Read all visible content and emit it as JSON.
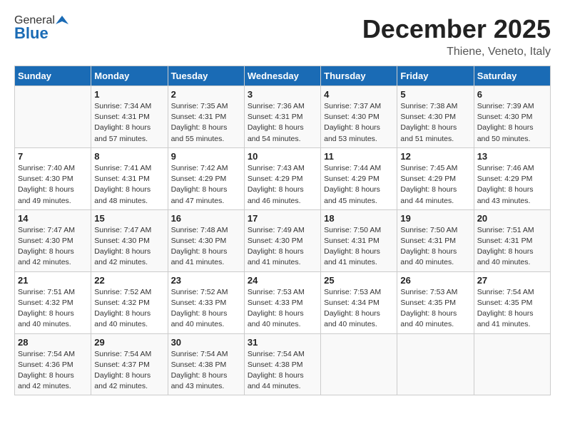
{
  "header": {
    "logo_general": "General",
    "logo_blue": "Blue",
    "month_title": "December 2025",
    "location": "Thiene, Veneto, Italy"
  },
  "days_of_week": [
    "Sunday",
    "Monday",
    "Tuesday",
    "Wednesday",
    "Thursday",
    "Friday",
    "Saturday"
  ],
  "weeks": [
    [
      {
        "day": "",
        "info": ""
      },
      {
        "day": "1",
        "info": "Sunrise: 7:34 AM\nSunset: 4:31 PM\nDaylight: 8 hours\nand 57 minutes."
      },
      {
        "day": "2",
        "info": "Sunrise: 7:35 AM\nSunset: 4:31 PM\nDaylight: 8 hours\nand 55 minutes."
      },
      {
        "day": "3",
        "info": "Sunrise: 7:36 AM\nSunset: 4:31 PM\nDaylight: 8 hours\nand 54 minutes."
      },
      {
        "day": "4",
        "info": "Sunrise: 7:37 AM\nSunset: 4:30 PM\nDaylight: 8 hours\nand 53 minutes."
      },
      {
        "day": "5",
        "info": "Sunrise: 7:38 AM\nSunset: 4:30 PM\nDaylight: 8 hours\nand 51 minutes."
      },
      {
        "day": "6",
        "info": "Sunrise: 7:39 AM\nSunset: 4:30 PM\nDaylight: 8 hours\nand 50 minutes."
      }
    ],
    [
      {
        "day": "7",
        "info": "Sunrise: 7:40 AM\nSunset: 4:30 PM\nDaylight: 8 hours\nand 49 minutes."
      },
      {
        "day": "8",
        "info": "Sunrise: 7:41 AM\nSunset: 4:31 PM\nDaylight: 8 hours\nand 48 minutes."
      },
      {
        "day": "9",
        "info": "Sunrise: 7:42 AM\nSunset: 4:29 PM\nDaylight: 8 hours\nand 47 minutes."
      },
      {
        "day": "10",
        "info": "Sunrise: 7:43 AM\nSunset: 4:29 PM\nDaylight: 8 hours\nand 46 minutes."
      },
      {
        "day": "11",
        "info": "Sunrise: 7:44 AM\nSunset: 4:29 PM\nDaylight: 8 hours\nand 45 minutes."
      },
      {
        "day": "12",
        "info": "Sunrise: 7:45 AM\nSunset: 4:29 PM\nDaylight: 8 hours\nand 44 minutes."
      },
      {
        "day": "13",
        "info": "Sunrise: 7:46 AM\nSunset: 4:29 PM\nDaylight: 8 hours\nand 43 minutes."
      }
    ],
    [
      {
        "day": "14",
        "info": "Sunrise: 7:47 AM\nSunset: 4:30 PM\nDaylight: 8 hours\nand 42 minutes."
      },
      {
        "day": "15",
        "info": "Sunrise: 7:47 AM\nSunset: 4:30 PM\nDaylight: 8 hours\nand 42 minutes."
      },
      {
        "day": "16",
        "info": "Sunrise: 7:48 AM\nSunset: 4:30 PM\nDaylight: 8 hours\nand 41 minutes."
      },
      {
        "day": "17",
        "info": "Sunrise: 7:49 AM\nSunset: 4:30 PM\nDaylight: 8 hours\nand 41 minutes."
      },
      {
        "day": "18",
        "info": "Sunrise: 7:50 AM\nSunset: 4:31 PM\nDaylight: 8 hours\nand 41 minutes."
      },
      {
        "day": "19",
        "info": "Sunrise: 7:50 AM\nSunset: 4:31 PM\nDaylight: 8 hours\nand 40 minutes."
      },
      {
        "day": "20",
        "info": "Sunrise: 7:51 AM\nSunset: 4:31 PM\nDaylight: 8 hours\nand 40 minutes."
      }
    ],
    [
      {
        "day": "21",
        "info": "Sunrise: 7:51 AM\nSunset: 4:32 PM\nDaylight: 8 hours\nand 40 minutes."
      },
      {
        "day": "22",
        "info": "Sunrise: 7:52 AM\nSunset: 4:32 PM\nDaylight: 8 hours\nand 40 minutes."
      },
      {
        "day": "23",
        "info": "Sunrise: 7:52 AM\nSunset: 4:33 PM\nDaylight: 8 hours\nand 40 minutes."
      },
      {
        "day": "24",
        "info": "Sunrise: 7:53 AM\nSunset: 4:33 PM\nDaylight: 8 hours\nand 40 minutes."
      },
      {
        "day": "25",
        "info": "Sunrise: 7:53 AM\nSunset: 4:34 PM\nDaylight: 8 hours\nand 40 minutes."
      },
      {
        "day": "26",
        "info": "Sunrise: 7:53 AM\nSunset: 4:35 PM\nDaylight: 8 hours\nand 40 minutes."
      },
      {
        "day": "27",
        "info": "Sunrise: 7:54 AM\nSunset: 4:35 PM\nDaylight: 8 hours\nand 41 minutes."
      }
    ],
    [
      {
        "day": "28",
        "info": "Sunrise: 7:54 AM\nSunset: 4:36 PM\nDaylight: 8 hours\nand 42 minutes."
      },
      {
        "day": "29",
        "info": "Sunrise: 7:54 AM\nSunset: 4:37 PM\nDaylight: 8 hours\nand 42 minutes."
      },
      {
        "day": "30",
        "info": "Sunrise: 7:54 AM\nSunset: 4:38 PM\nDaylight: 8 hours\nand 43 minutes."
      },
      {
        "day": "31",
        "info": "Sunrise: 7:54 AM\nSunset: 4:38 PM\nDaylight: 8 hours\nand 44 minutes."
      },
      {
        "day": "",
        "info": ""
      },
      {
        "day": "",
        "info": ""
      },
      {
        "day": "",
        "info": ""
      }
    ]
  ]
}
